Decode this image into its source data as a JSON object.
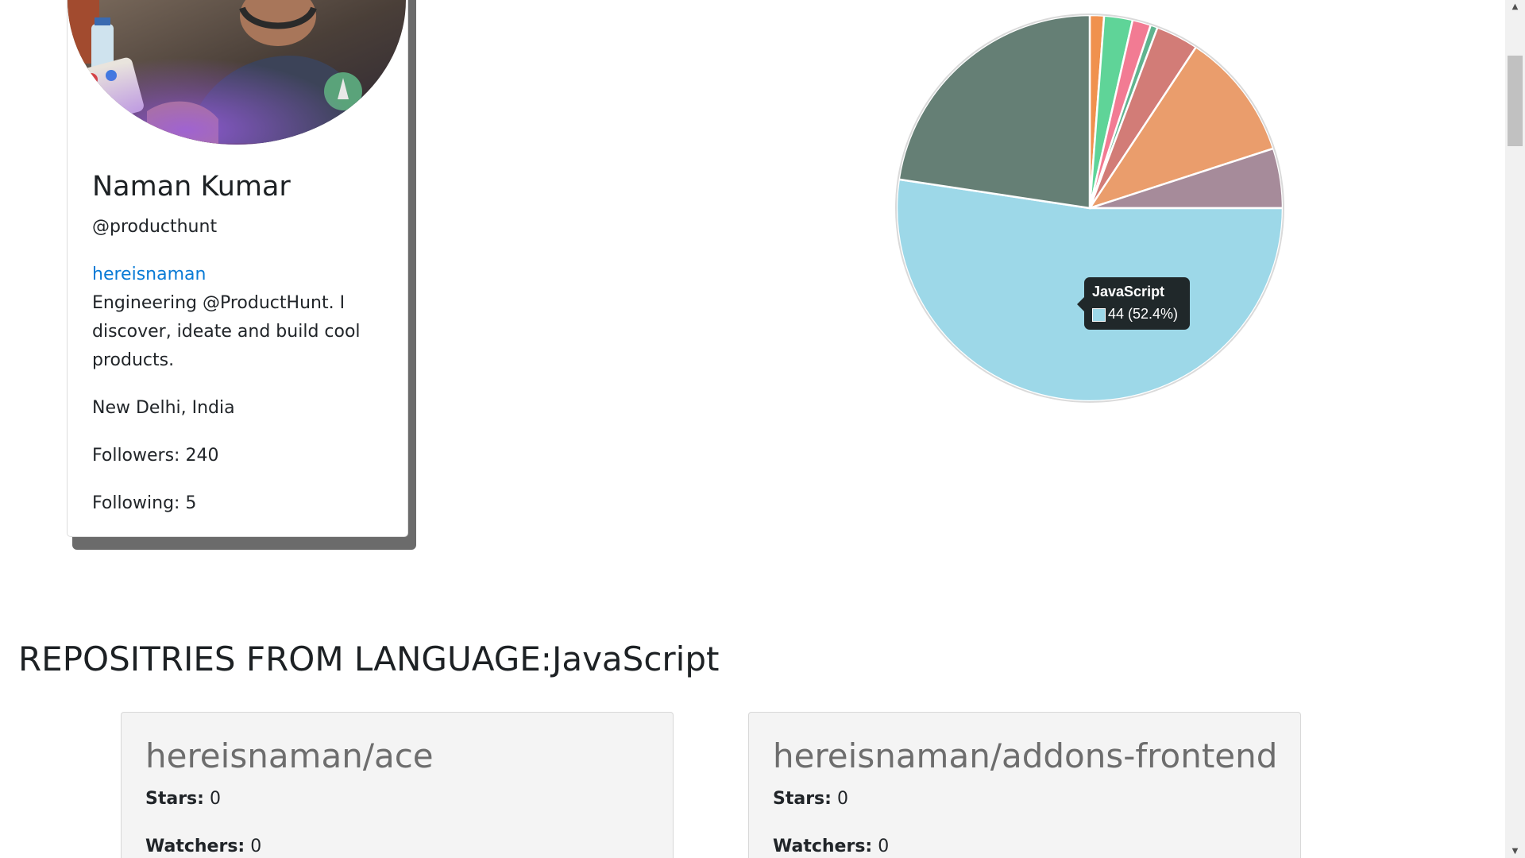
{
  "profile": {
    "name": "Naman Kumar",
    "handle": "@producthunt",
    "link_text": "hereisnaman",
    "bio": "Engineering @ProductHunt. I discover, ideate and build cool products.",
    "location": "New Delhi, India",
    "followers": "Followers: 240",
    "following": "Following: 5"
  },
  "chart_data": {
    "type": "pie",
    "values": [
      1,
      2,
      1.3,
      0.5,
      3,
      9,
      4.2,
      44,
      19
    ],
    "colors": [
      "#f0914e",
      "#5fd498",
      "#f27b93",
      "#5fb48f",
      "#d27c77",
      "#ea9d6c",
      "#a68b9a",
      "#9dd8e8",
      "#657f75"
    ],
    "tooltip": {
      "label": "JavaScript",
      "value": "44 (52.4%)",
      "color": "#9dd8e8"
    }
  },
  "section": {
    "heading": "REPOSITRIES FROM LANGUAGE:JavaScript"
  },
  "repos": [
    {
      "title": "hereisnaman/ace",
      "stars_label": "Stars:",
      "stars": "0",
      "watchers_label": "Watchers:",
      "watchers": "0"
    },
    {
      "title": "hereisnaman/addons-frontend",
      "stars_label": "Stars:",
      "stars": "0",
      "watchers_label": "Watchers:",
      "watchers": "0"
    }
  ],
  "scrollbar": {
    "up_icon": "triangle-up-icon",
    "down_icon": "triangle-down-icon"
  }
}
